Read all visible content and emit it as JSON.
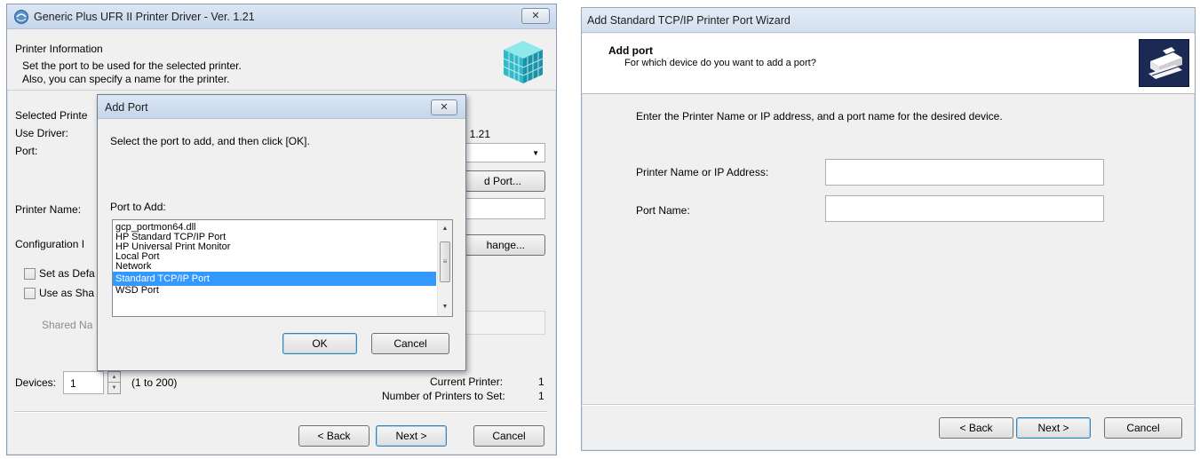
{
  "driver_window": {
    "title": "Generic Plus UFR II Printer Driver - Ver. 1.21",
    "header_title": "Printer Information",
    "header_line1": "Set the port to be used for the selected printer.",
    "header_line2": "Also, you can specify a name for the printer.",
    "selected_printer_label": "Selected Printe",
    "use_driver_label": "Use Driver:",
    "use_driver_value_partial": ". 1.21",
    "port_label": "Port:",
    "add_port_button_partial": "d Port...",
    "printer_name_label": "Printer Name:",
    "configuration_label": "Configuration I",
    "change_button_partial": "hange...",
    "set_default_label": "Set as Defa",
    "use_shared_label": "Use as Sha",
    "shared_name_label": "Shared Na",
    "devices_label": "Devices:",
    "devices_value": "1",
    "devices_range": "(1 to 200)",
    "current_printer_label": "Current Printer:",
    "current_printer_value": "1",
    "number_to_set_label": "Number of Printers to Set:",
    "number_to_set_value": "1",
    "back_button": "< Back",
    "next_button": "Next >",
    "cancel_button": "Cancel"
  },
  "add_port_dialog": {
    "title": "Add Port",
    "instruction": "Select the port to add, and then click [OK].",
    "port_to_add_label": "Port to Add:",
    "ports": [
      "gcp_portmon64.dll",
      "HP Standard TCP/IP Port",
      "HP Universal Print Monitor",
      "Local Port",
      "Network",
      "Standard TCP/IP Port",
      "WSD Port"
    ],
    "selected_port": "Standard TCP/IP Port",
    "ok_button": "OK",
    "cancel_button": "Cancel"
  },
  "wizard_window": {
    "title": "Add Standard TCP/IP Printer Port Wizard",
    "header_title": "Add port",
    "header_subtitle": "For which device do you want to add a port?",
    "instruction": "Enter the Printer Name or IP address, and a port name for the desired device.",
    "printer_name_ip_label": "Printer Name or IP Address:",
    "printer_name_ip_value": "",
    "port_name_label": "Port Name:",
    "port_name_value": "",
    "back_button": "< Back",
    "next_button": "Next >",
    "cancel_button": "Cancel"
  },
  "icons": [
    "printer-driver-icon",
    "cube-icon",
    "close-icon",
    "dropdown-arrow-icon",
    "spinner-icon",
    "scroll-up-icon",
    "scroll-down-icon",
    "printer-wizard-icon"
  ],
  "colors": {
    "selection": "#3399ff",
    "titlebar": "#dbe7f5",
    "wizard_icon_bg": "#1b2a55"
  }
}
